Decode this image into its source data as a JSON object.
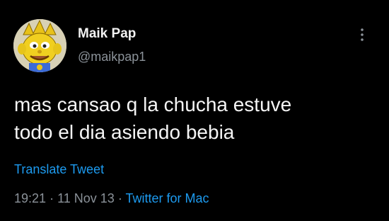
{
  "tweet": {
    "author": {
      "name": "Maik Pap",
      "handle": "@maikpap1"
    },
    "text_lines": [
      "mas cansao q la chucha estuve",
      "todo el dia asiendo bebia"
    ],
    "translate_label": "Translate Tweet",
    "time": "19:21",
    "separator": "·",
    "date": "11 Nov 13",
    "source": "Twitter for Mac"
  },
  "icons": {
    "more": "more-vertical-icon",
    "avatar": "avatar-cartoon-character"
  },
  "colors": {
    "background": "#000000",
    "text": "#f5f5f5",
    "secondary": "#8b9299",
    "link": "#1d9bf0"
  }
}
